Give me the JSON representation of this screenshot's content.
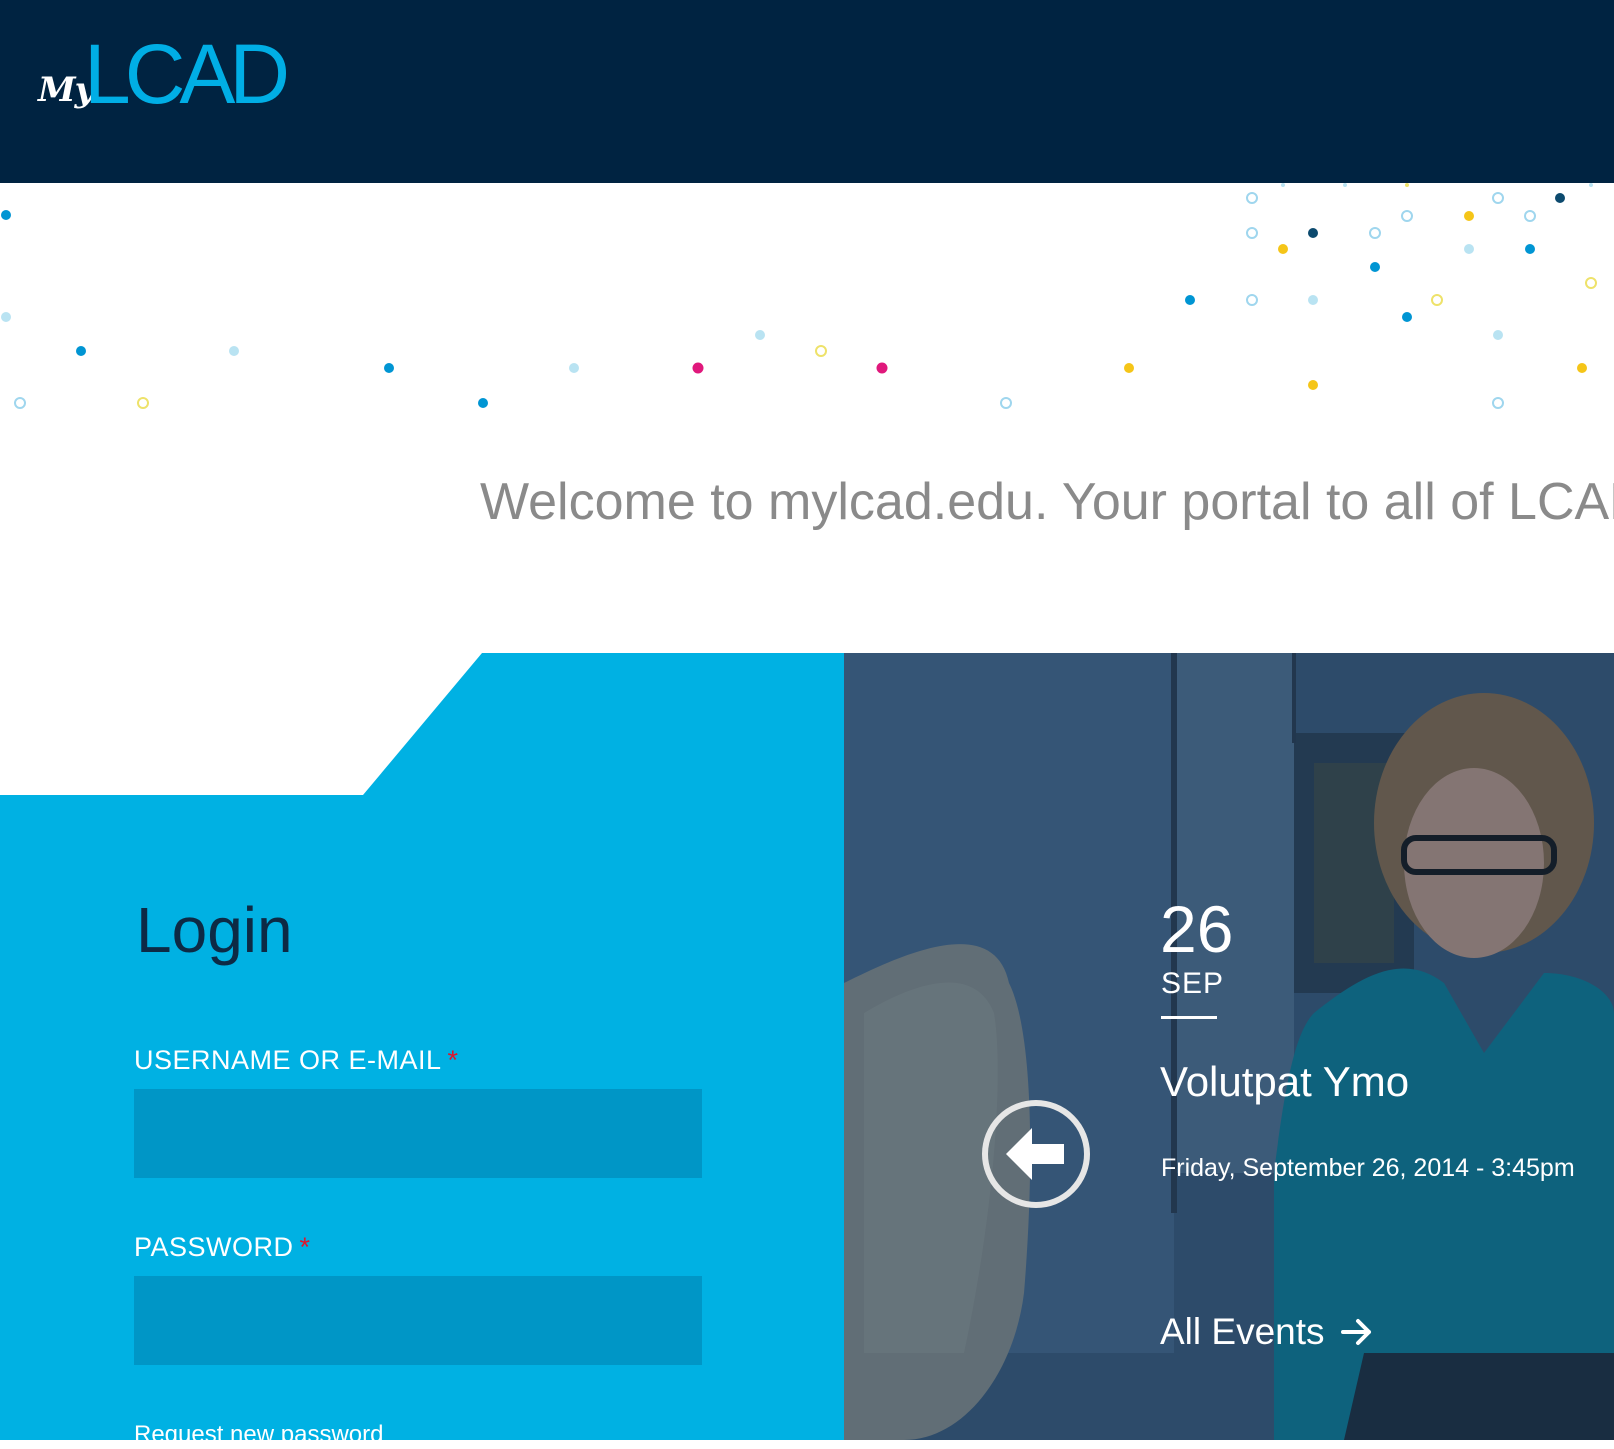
{
  "header": {
    "logo_script": "My",
    "logo_wordmark": "LCAD",
    "background_color": "#002341",
    "logo_color": "#00aee5"
  },
  "welcome": {
    "text": "Welcome to mylcad.edu. Your portal to all of LCAD"
  },
  "login": {
    "title": "Login",
    "username_label": "USERNAME OR E-MAIL",
    "password_label": "PASSWORD",
    "required_mark": "*",
    "username_value": "",
    "password_value": "",
    "request_password_link": "Request new password",
    "panel_color": "#00b1e3",
    "input_color": "#0096c6"
  },
  "event": {
    "day": "26",
    "month": "SEP",
    "title": "Volutpat Ymo",
    "datetime": "Friday, September 26, 2014 - 3:45pm",
    "all_events_label": "All Events",
    "prev_icon": "arrow-left-circle-icon",
    "all_events_icon": "arrow-right-icon"
  }
}
